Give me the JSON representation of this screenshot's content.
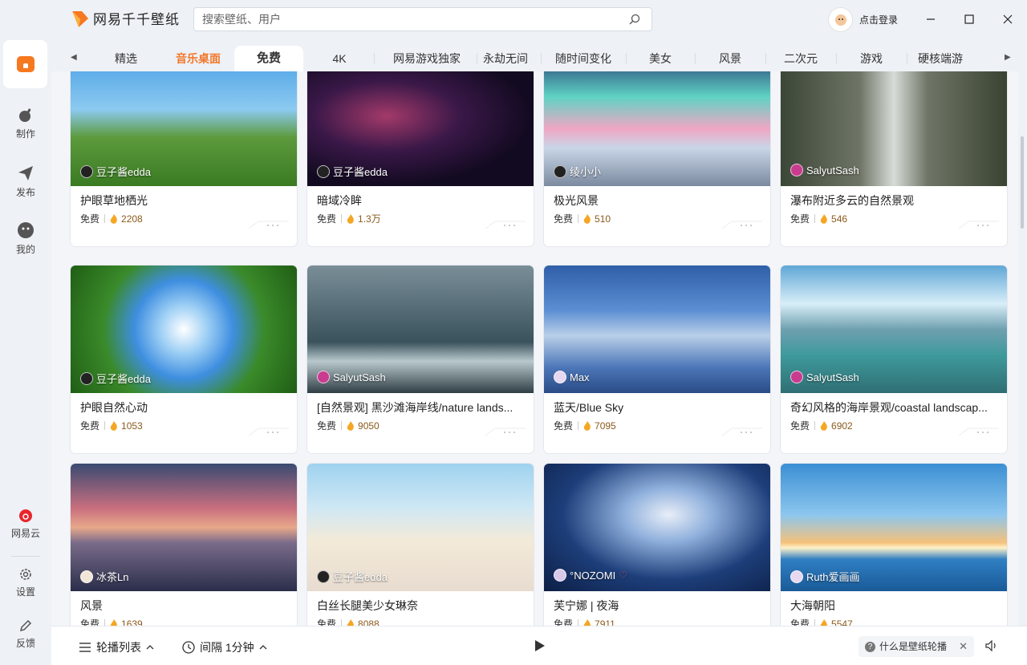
{
  "app": {
    "name": "网易千千壁纸"
  },
  "search": {
    "placeholder": "搜索壁纸、用户"
  },
  "login": {
    "label": "点击登录"
  },
  "sidebar": {
    "items": [
      {
        "label": "制作",
        "icon": "magic-pen-icon"
      },
      {
        "label": "发布",
        "icon": "send-icon"
      },
      {
        "label": "我的",
        "icon": "profile-icon"
      },
      {
        "label": "网易云",
        "icon": "netease-cloud-music-icon"
      },
      {
        "label": "设置",
        "icon": "gear-icon"
      },
      {
        "label": "反馈",
        "icon": "pencil-icon"
      }
    ]
  },
  "tabs": [
    "精选",
    "音乐桌面",
    "免费",
    "4K",
    "网易游戏独家",
    "永劫无间",
    "随时间变化",
    "美女",
    "风景",
    "二次元",
    "游戏",
    "硬核端游"
  ],
  "active_tab": "免费",
  "cards": [
    {
      "author": "豆子酱edda",
      "title": "护眼草地栖光",
      "price": "免费",
      "likes": "2208"
    },
    {
      "author": "豆子酱edda",
      "title": "暗域冷眸",
      "price": "免费",
      "likes": "1.3万"
    },
    {
      "author": "绫小小",
      "title": "极光风景",
      "price": "免费",
      "likes": "510"
    },
    {
      "author": "SalyutSash",
      "title": "瀑布附近多云的自然景观",
      "price": "免费",
      "likes": "546"
    },
    {
      "author": "豆子酱edda",
      "title": "护眼自然心动",
      "price": "免费",
      "likes": "1053"
    },
    {
      "author": "SalyutSash",
      "title": "[自然景观] 黑沙滩海岸线/nature lands...",
      "price": "免费",
      "likes": "9050"
    },
    {
      "author": "Max",
      "title": "蓝天/Blue Sky",
      "price": "免费",
      "likes": "7095"
    },
    {
      "author": "SalyutSash",
      "title": "奇幻风格的海岸景观/coastal landscap...",
      "price": "免费",
      "likes": "6902"
    },
    {
      "author": "冰茶Ln",
      "title": "风景",
      "price": "免费",
      "likes": "1639"
    },
    {
      "author": "豆子酱edda",
      "title": "白丝长腿美少女琳奈",
      "price": "免费",
      "likes": "8088"
    },
    {
      "author": "°NOZOMI",
      "title": "芙宁娜 | 夜海",
      "price": "免费",
      "likes": "7911"
    },
    {
      "author": "Ruth爱画画",
      "title": "大海朝阳",
      "price": "免费",
      "likes": "5547"
    }
  ],
  "bottom": {
    "playlist_label": "轮播列表",
    "interval_label": "间隔 1分钟",
    "help_label": "什么是壁纸轮播"
  },
  "colors": {
    "accent": "#f6781f",
    "background": "#eef1f6"
  }
}
